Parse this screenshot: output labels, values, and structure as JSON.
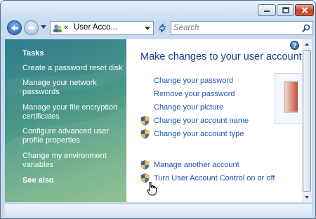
{
  "titlebar": {
    "buttons": {
      "minimize": "minimize-icon",
      "maximize": "maximize-icon",
      "close": "close-icon"
    }
  },
  "navigation": {
    "back_icon": "back-arrow-icon",
    "forward_icon": "forward-arrow-icon",
    "breadcrumb_prefix": "«",
    "address_text": "User Acco...",
    "search_placeholder": "Search"
  },
  "taskpane": {
    "heading": "Tasks",
    "tasks": [
      {
        "label": "Create a password reset disk"
      },
      {
        "label": "Manage your network passwords"
      },
      {
        "label": "Manage your file encryption certificates"
      },
      {
        "label": "Configure advanced user profile properties"
      },
      {
        "label": "Change my environment variables"
      }
    ],
    "see_also": "See also"
  },
  "main": {
    "heading": "Make changes to your user account",
    "actions": [
      {
        "label": "Change your password",
        "shield": false
      },
      {
        "label": "Remove your password",
        "shield": false
      },
      {
        "label": "Change your picture",
        "shield": false
      },
      {
        "label": "Change your account name",
        "shield": true
      },
      {
        "label": "Change your account type",
        "shield": true
      },
      {
        "label": "Manage another account",
        "shield": true
      },
      {
        "label": "Turn User Account Control on or off",
        "shield": true
      }
    ]
  },
  "colors": {
    "link": "#1c55b4",
    "heading": "#1e3c8c",
    "taskpane_top": "#2f7b8e",
    "taskpane_bottom": "#8dbd90"
  }
}
